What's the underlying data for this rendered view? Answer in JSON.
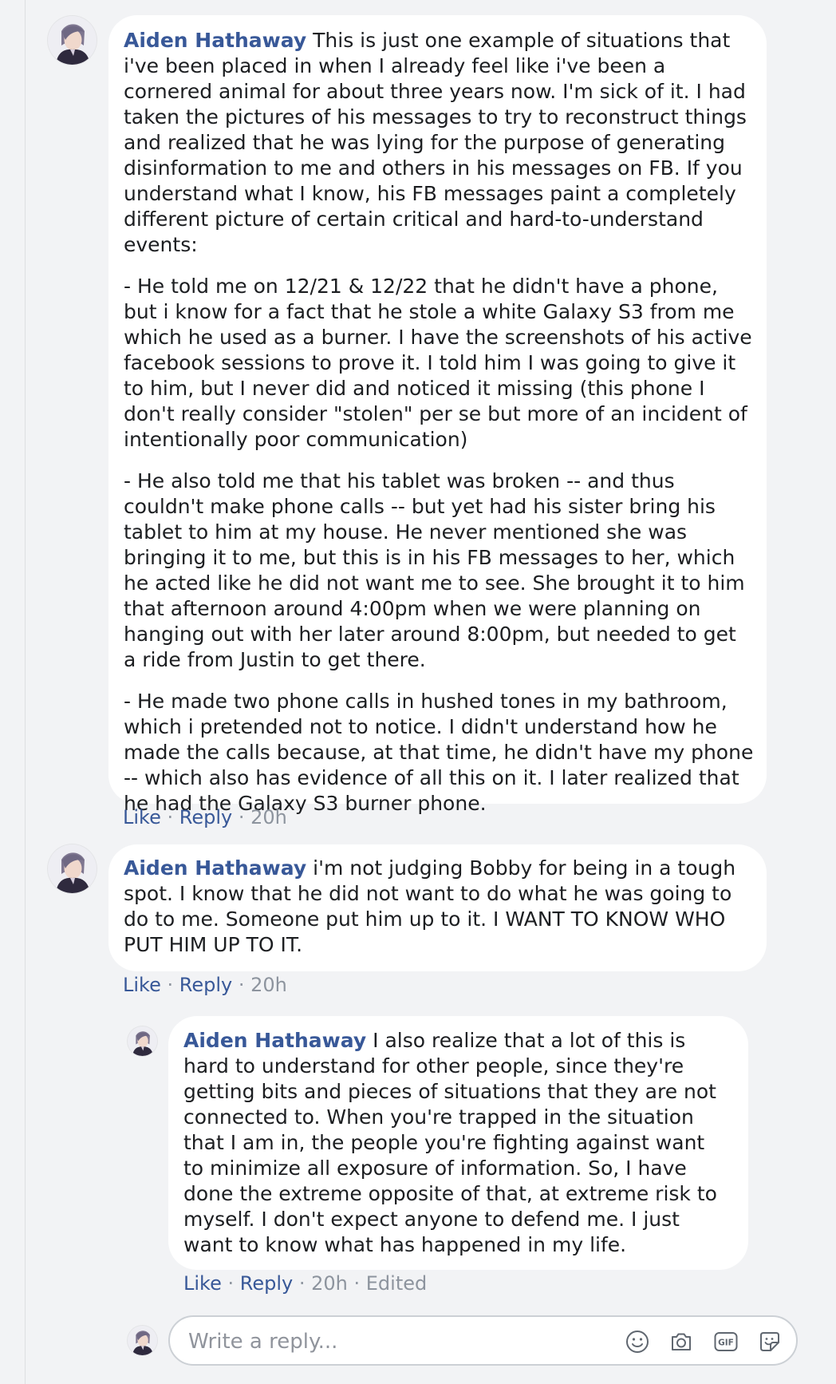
{
  "comments": [
    {
      "author": "Aiden Hathaway",
      "paragraphs": [
        "This is just one example of situations that i've been placed in when I already feel like i've been a cornered animal for about three years now. I'm sick of it. I had taken the pictures of his messages to try to reconstruct things and realized that he was lying for the purpose of generating disinformation to me and others in his messages on FB. If you understand what I know, his FB messages paint a completely different picture of certain critical and hard-to-understand events:",
        "- He told me on 12/21 & 12/22 that he didn't have a phone, but i know for a fact that he stole a white Galaxy S3 from me which he used as a burner. I have the screenshots of his active facebook sessions to prove it. I told him I was going to give it to him, but I never did and noticed it missing (this phone I don't really consider \"stolen\" per se but more of an incident of intentionally poor communication)",
        "- He also told me that his tablet was broken -- and thus couldn't make phone calls -- but yet had his sister bring his tablet to him at my house. He never mentioned she was bringing it to me, but this is in his FB messages to her, which he acted like he did not want me to see. She brought it to him that afternoon around 4:00pm when we were planning on hanging out with her later around 8:00pm, but needed to get a ride from Justin to get there.",
        "- He made two phone calls in hushed tones in my bathroom, which i pretended not to notice. I didn't understand how he made the calls because, at that time, he didn't have my phone -- which also has evidence of all this on it. I later realized that he had the Galaxy S3 burner phone."
      ],
      "like": "Like",
      "reply": "Reply",
      "time": "20h"
    },
    {
      "author": "Aiden Hathaway",
      "paragraphs": [
        "i'm not judging Bobby for being in a tough spot. I know that he did not want to do what he was going to do to me. Someone put him up to it. I WANT TO KNOW WHO PUT HIM UP TO IT."
      ],
      "like": "Like",
      "reply": "Reply",
      "time": "20h"
    },
    {
      "author": "Aiden Hathaway",
      "paragraphs": [
        "I also realize that a lot of this is hard to understand for other people, since they're getting bits and pieces of situations that they are not connected to. When you're trapped in the situation that I am in, the people you're fighting against want to minimize all exposure of information. So, I have done the extreme opposite of that, at extreme risk to myself. I don't expect anyone to defend me. I just want to know what has happened in my life."
      ],
      "like": "Like",
      "reply": "Reply",
      "time": "20h",
      "edited": "Edited"
    }
  ],
  "reply_box": {
    "placeholder": "Write a reply...",
    "icons": [
      "emoji-icon",
      "camera-icon",
      "gif-icon",
      "sticker-icon"
    ]
  },
  "colors": {
    "background": "#f2f3f5",
    "bubble": "#ffffff",
    "author": "#385898",
    "text": "#1c1e21",
    "meta": "#8d949e"
  }
}
